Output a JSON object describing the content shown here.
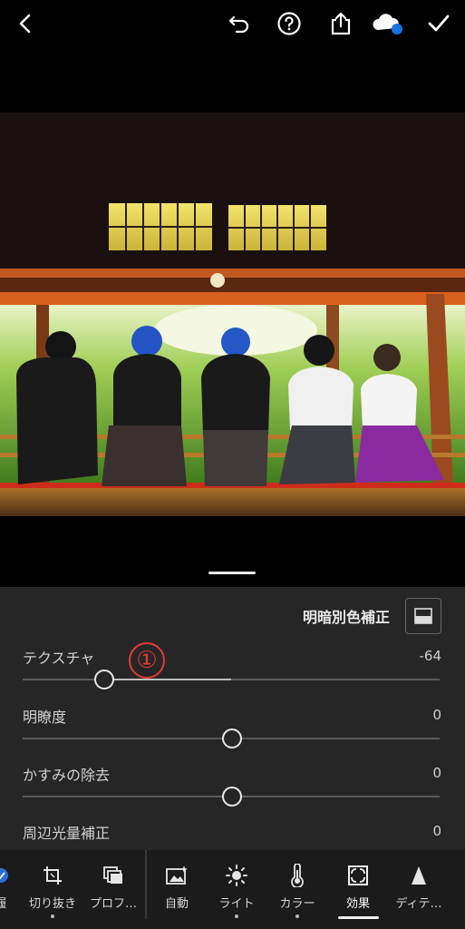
{
  "top_bar": {
    "icons": [
      "back-icon",
      "undo-icon",
      "help-icon",
      "share-icon",
      "cloud-sync-icon",
      "done-check-icon"
    ]
  },
  "panel": {
    "title": "明暗別色補正",
    "sliders": [
      {
        "label": "テクスチャ",
        "value": "-64",
        "fraction": 0.19
      },
      {
        "label": "明瞭度",
        "value": "0",
        "fraction": 0.5
      },
      {
        "label": "かすみの除去",
        "value": "0",
        "fraction": 0.5
      },
      {
        "label": "周辺光量補正",
        "value": "0",
        "fraction": 0.5
      }
    ],
    "annotation": "①"
  },
  "toolbar": {
    "items": [
      {
        "label": "履",
        "icon": "presets-icon"
      },
      {
        "label": "切り抜き",
        "icon": "crop-icon"
      },
      {
        "label": "プロフ…",
        "icon": "profile-icon"
      },
      {
        "label": "自動",
        "icon": "auto-icon"
      },
      {
        "label": "ライト",
        "icon": "light-icon"
      },
      {
        "label": "カラー",
        "icon": "color-icon"
      },
      {
        "label": "効果",
        "icon": "effects-icon",
        "active": true
      },
      {
        "label": "ディテ…",
        "icon": "detail-icon"
      }
    ]
  }
}
